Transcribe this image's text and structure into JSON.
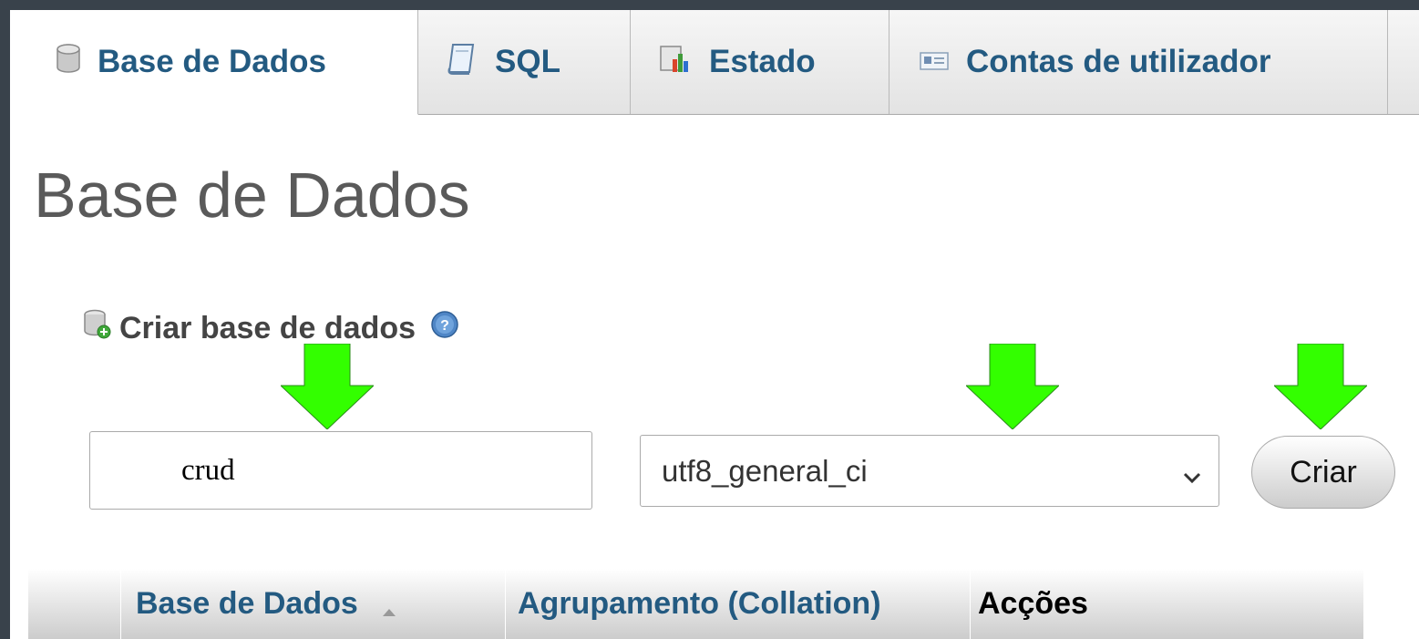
{
  "tabs": [
    {
      "label": "Base de Dados",
      "icon": "database-icon",
      "active": true
    },
    {
      "label": "SQL",
      "icon": "sql-document-icon",
      "active": false
    },
    {
      "label": "Estado",
      "icon": "status-chart-icon",
      "active": false
    },
    {
      "label": "Contas de utilizador",
      "icon": "user-accounts-icon",
      "active": false
    }
  ],
  "page": {
    "title": "Base de Dados"
  },
  "create_db": {
    "label": "Criar base de dados",
    "name_value": "crud",
    "collation_value": "utf8_general_ci",
    "button_label": "Criar"
  },
  "table": {
    "headers": {
      "database": "Base de Dados",
      "collation": "Agrupamento (Collation)",
      "actions": "Acções"
    }
  },
  "colors": {
    "arrow": "#33ff00",
    "link": "#235a81",
    "background_frame": "#39424b"
  }
}
